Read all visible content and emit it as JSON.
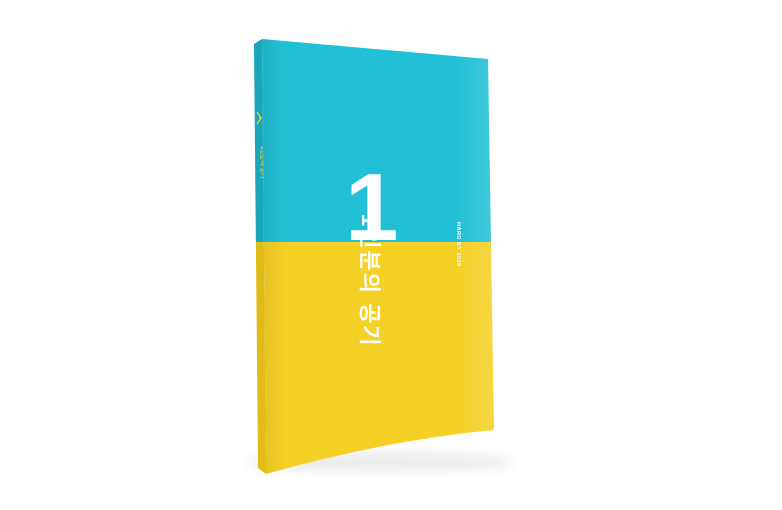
{
  "scene": {
    "subject": "book-mockup",
    "colors": {
      "background": "#ffffff",
      "cyan": "#22c0d6",
      "cyan_dark": "#1aa6ba",
      "yellow": "#f5d126",
      "yellow_dark": "#e2bc16",
      "title_text": "#ffffff",
      "spine_accent": "#f5d126"
    }
  },
  "cover": {
    "number": "1",
    "title": "1인분의 공기",
    "tagline": "HARD BY 2020"
  },
  "spine": {
    "title": "1인분의 공기"
  }
}
